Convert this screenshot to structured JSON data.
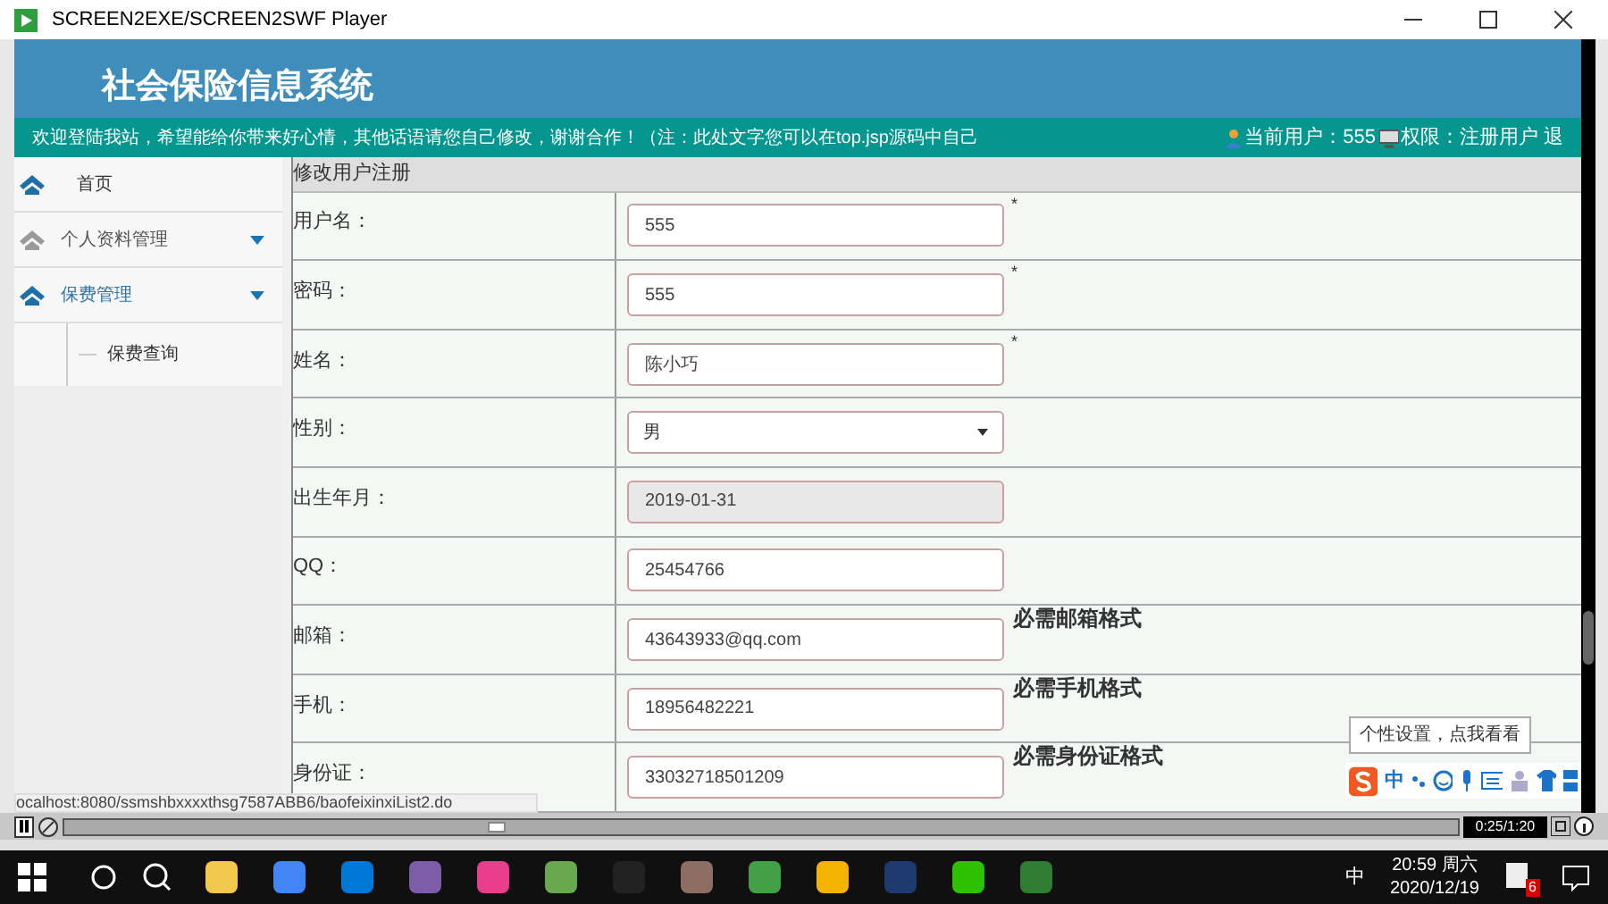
{
  "window": {
    "title": "SCREEN2EXE/SCREEN2SWF Player"
  },
  "header": {
    "title": "社会保险信息系统",
    "marquee": "欢迎登陆我站，希望能给你带来好心情，其他话语请您自己修改，谢谢合作！（注：此处文字您可以在top.jsp源码中自己",
    "current_user": "当前用户：555",
    "role": "权限：注册用户",
    "cut_word": "退"
  },
  "sidebar": {
    "items": [
      {
        "label": "首页",
        "kind": "link"
      },
      {
        "label": "个人资料管理",
        "kind": "menu",
        "expanded": false
      },
      {
        "label": "保费管理",
        "kind": "menu",
        "expanded": true,
        "children": [
          {
            "label": "保费查询"
          }
        ]
      }
    ]
  },
  "form": {
    "title": "修改用户注册",
    "required_mark": "*",
    "rows": [
      {
        "label": "用户名：",
        "value": "555",
        "kind": "text",
        "required": true
      },
      {
        "label": "密码：",
        "value": "555",
        "kind": "text",
        "required": true
      },
      {
        "label": "姓名：",
        "value": "陈小巧",
        "kind": "text",
        "required": true
      },
      {
        "label": "性别：",
        "value": "男",
        "kind": "select",
        "required": false
      },
      {
        "label": "出生年月：",
        "value": "2019-01-31",
        "kind": "readonly",
        "required": false
      },
      {
        "label": "QQ：",
        "value": "25454766",
        "kind": "text",
        "required": false
      },
      {
        "label": "邮箱：",
        "value": "43643933@qq.com",
        "kind": "text",
        "required": false,
        "hint": "必需邮箱格式"
      },
      {
        "label": "手机：",
        "value": "18956482221",
        "kind": "text",
        "required": false,
        "hint": "必需手机格式"
      },
      {
        "label": "身份证：",
        "value": "33032718501209",
        "kind": "text",
        "required": false,
        "hint": "必需身份证格式"
      }
    ]
  },
  "status_url": "ocalhost:8080/ssmshbxxxxthsg7587ABB6/baofeixinxiList2.do",
  "ime": {
    "tooltip": "个性设置，点我看看",
    "mode": "中"
  },
  "player": {
    "time": "0:25/1:20",
    "level": 0.31
  },
  "taskbar": {
    "ime": "中",
    "time": "20:59 周六",
    "date": "2020/12/19",
    "badge": "6"
  }
}
